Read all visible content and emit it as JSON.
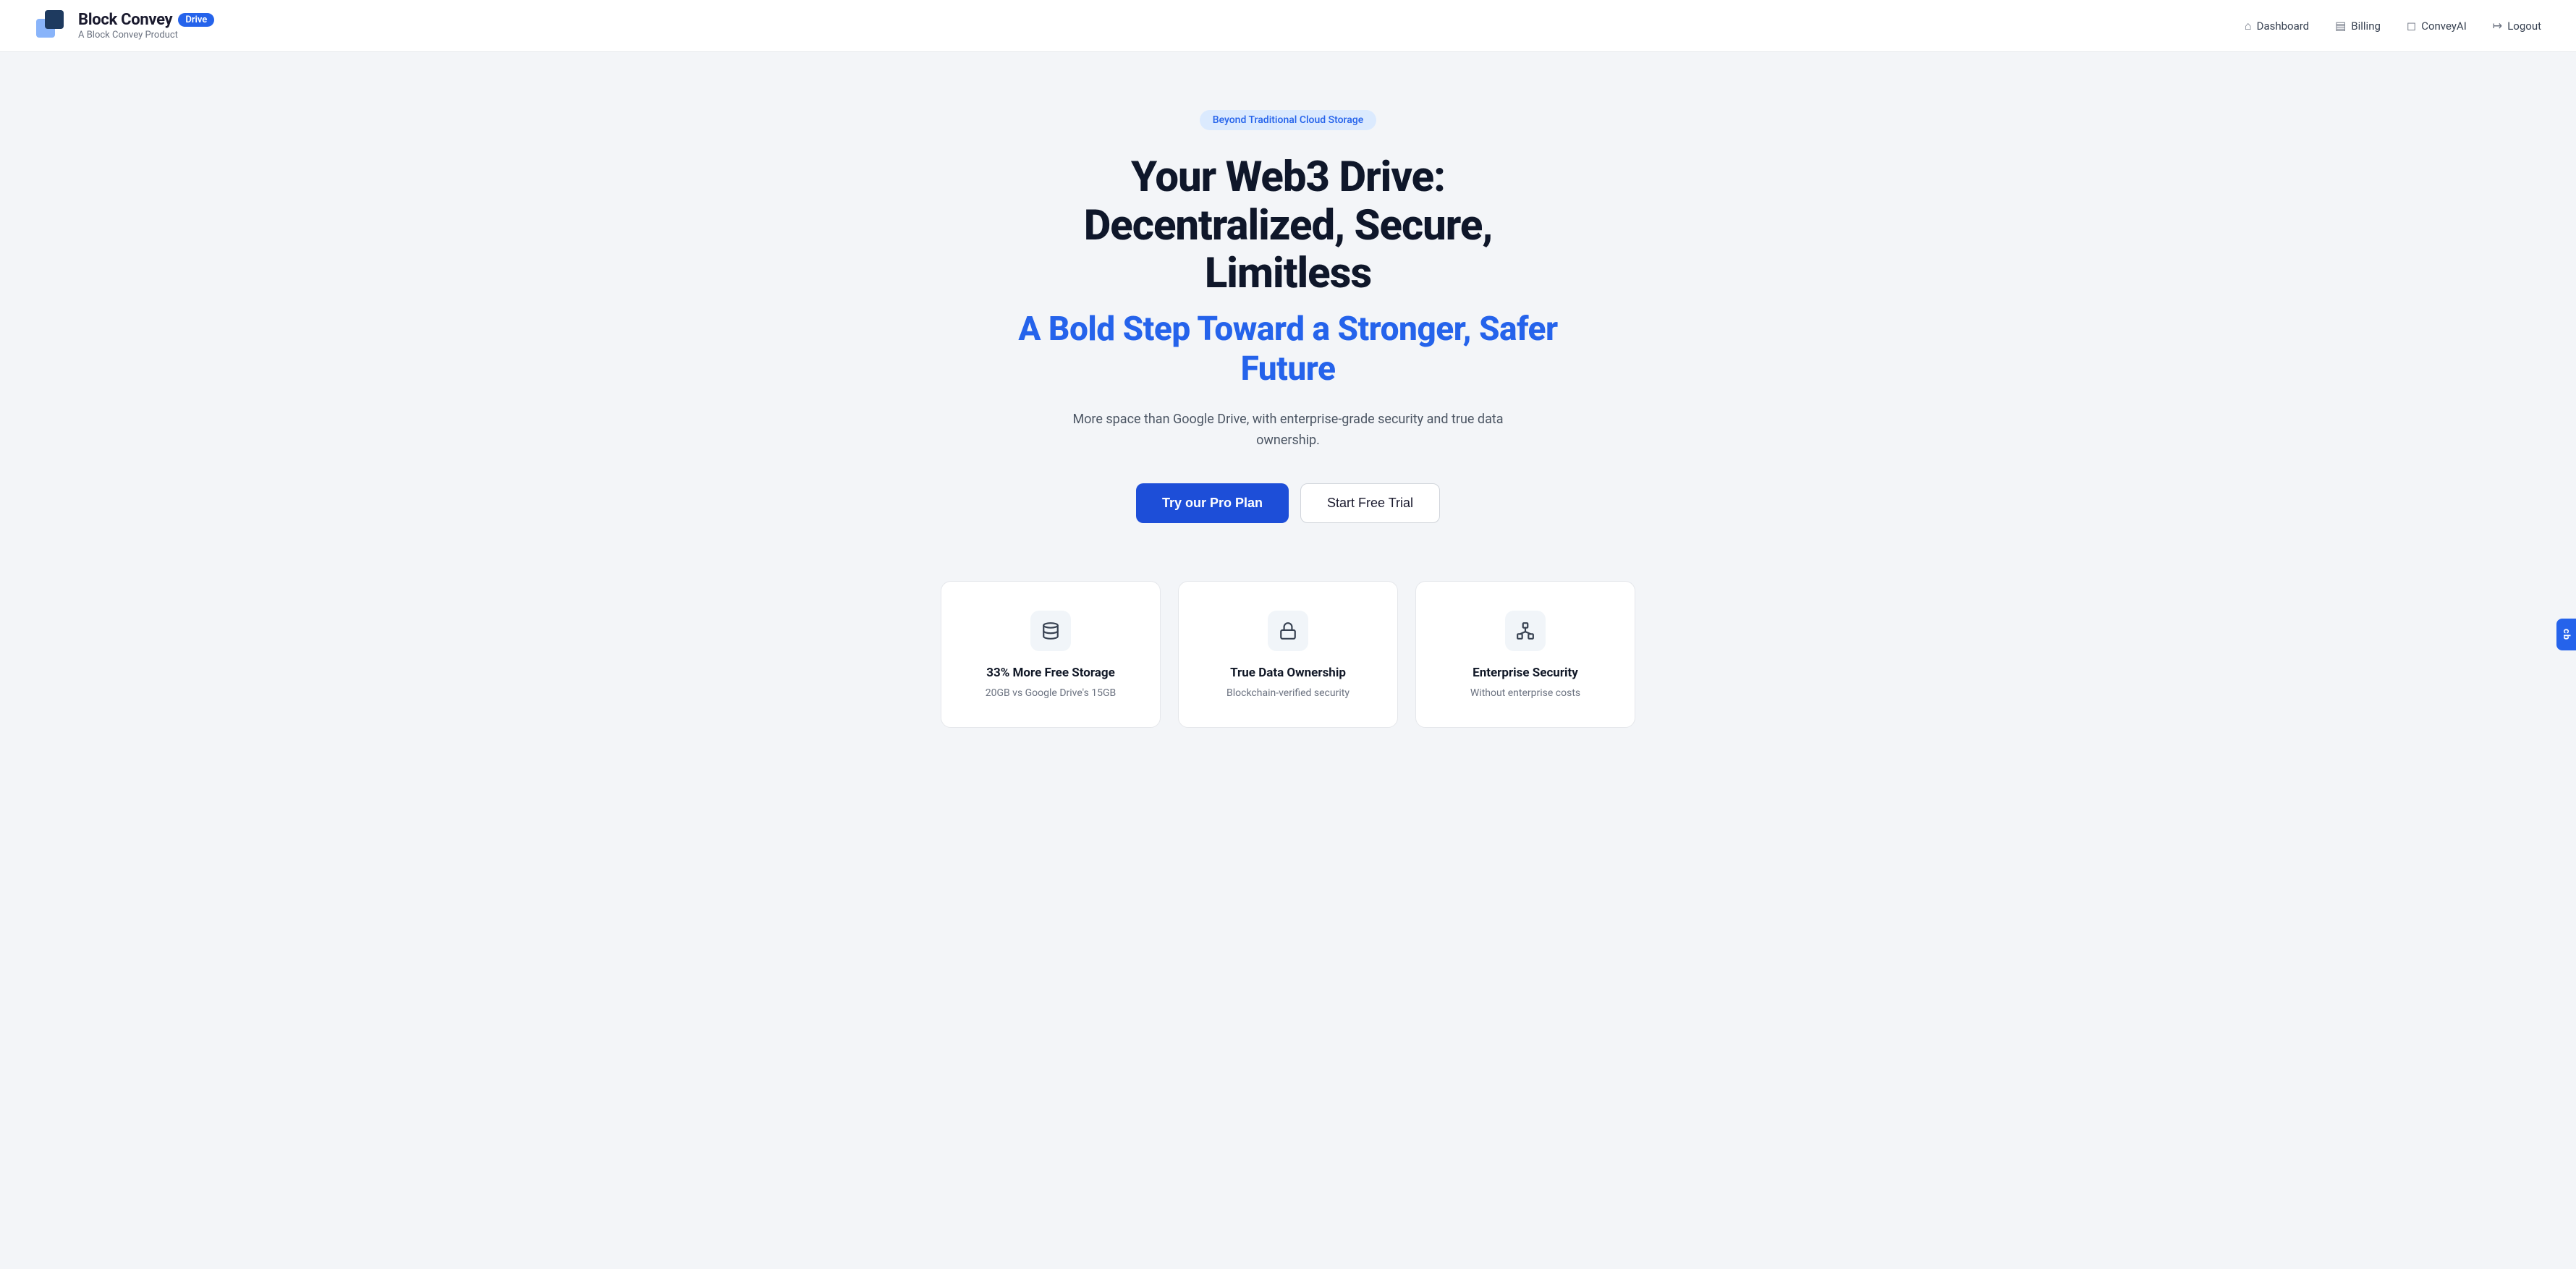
{
  "navbar": {
    "logo_title": "Block Convey",
    "logo_badge": "Drive",
    "logo_subtitle": "A Block Convey Product",
    "nav_items": [
      {
        "id": "dashboard",
        "label": "Dashboard",
        "icon": "house"
      },
      {
        "id": "billing",
        "label": "Billing",
        "icon": "receipt"
      },
      {
        "id": "conveyai",
        "label": "ConveyAI",
        "icon": "chat"
      },
      {
        "id": "logout",
        "label": "Logout",
        "icon": "logout"
      }
    ]
  },
  "hero": {
    "badge": "Beyond Traditional Cloud Storage",
    "title": "Your Web3 Drive: Decentralized, Secure, Limitless",
    "subtitle": "A Bold Step Toward a Stronger, Safer Future",
    "description": "More space than Google Drive, with enterprise-grade security and true data ownership.",
    "cta_primary": "Try our Pro Plan",
    "cta_secondary": "Start Free Trial"
  },
  "features": [
    {
      "id": "storage",
      "icon": "database",
      "title": "33% More Free Storage",
      "description": "20GB vs Google Drive's 15GB"
    },
    {
      "id": "ownership",
      "icon": "lock",
      "title": "True Data Ownership",
      "description": "Blockchain-verified security"
    },
    {
      "id": "security",
      "icon": "network",
      "title": "Enterprise Security",
      "description": "Without enterprise costs"
    }
  ],
  "side_widget": {
    "label": "cb"
  }
}
